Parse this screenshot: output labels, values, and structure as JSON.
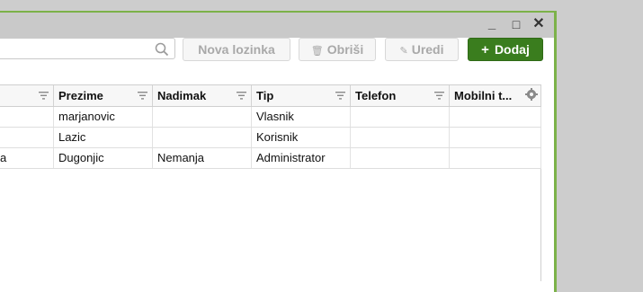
{
  "window": {
    "controls": {
      "minimize": "_",
      "maximize": "□",
      "close": "✕"
    }
  },
  "toolbar": {
    "search": {
      "value": "",
      "placeholder": "",
      "icon": "search-icon"
    },
    "nova_lozinka": "Nova lozinka",
    "obrisi": "Obriši",
    "uredi": "Uredi",
    "dodaj": "Dodaj",
    "accent": "#3a7d1e"
  },
  "grid": {
    "columns": [
      {
        "label": ""
      },
      {
        "label": "Prezime"
      },
      {
        "label": "Nadimak"
      },
      {
        "label": "Tip"
      },
      {
        "label": "Telefon"
      },
      {
        "label": "Mobilni t..."
      }
    ],
    "rows": [
      [
        "",
        "marjanovic",
        "",
        "Vlasnik",
        "",
        ""
      ],
      [
        "",
        "Lazic",
        "",
        "Korisnik",
        "",
        ""
      ],
      [
        "a",
        "Dugonjic",
        "Nemanja",
        "Administrator",
        "",
        ""
      ]
    ]
  }
}
